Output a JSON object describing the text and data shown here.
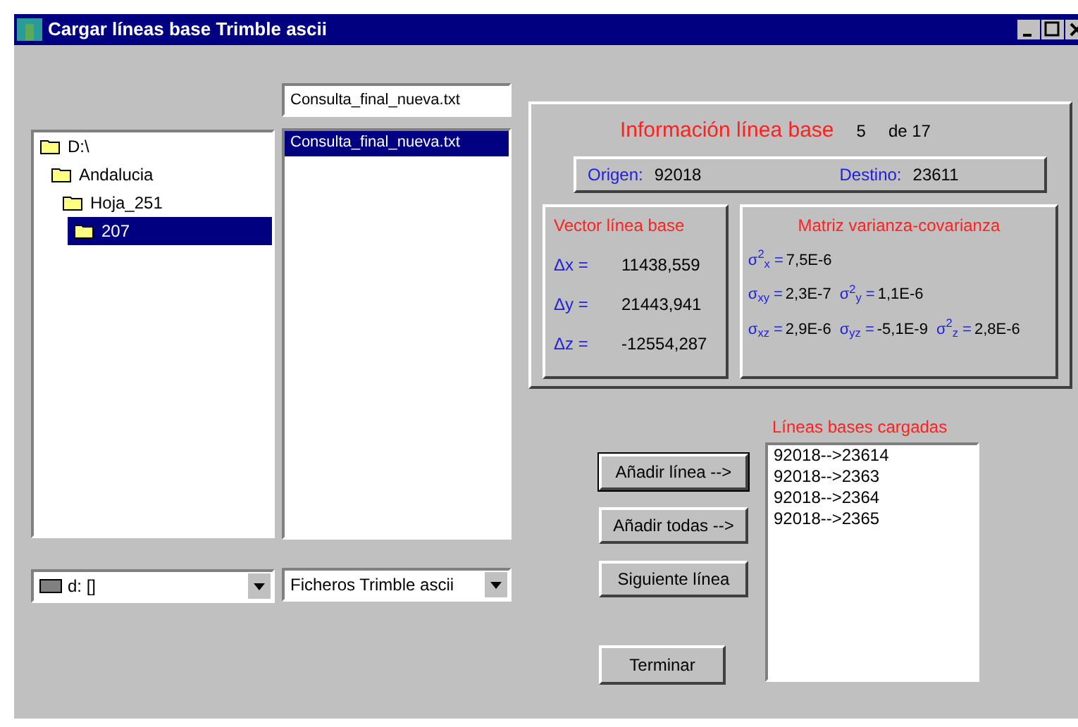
{
  "window": {
    "title": "Cargar líneas base Trimble ascii"
  },
  "folder_tree": [
    {
      "label": "D:\\",
      "selected": false,
      "children": [
        {
          "label": "Andalucia",
          "selected": false,
          "children": [
            {
              "label": "Hoja_251",
              "selected": false,
              "children": [
                {
                  "label": "207",
                  "selected": true
                }
              ]
            }
          ]
        }
      ]
    }
  ],
  "drive_select": {
    "value": "d: []"
  },
  "file_name": {
    "value": "Consulta_final_nueva.txt"
  },
  "file_list": [
    {
      "label": "Consulta_final_nueva.txt",
      "selected": true
    }
  ],
  "file_type_select": {
    "value": "Ficheros Trimble ascii"
  },
  "info": {
    "title": "Información línea base",
    "index": "5",
    "of": "de 17",
    "origin_label": "Origen:",
    "origin": "92018",
    "destination_label": "Destino:",
    "destination": "23611",
    "vector_title": "Vector línea base",
    "vector": [
      {
        "label": "Δx =",
        "value": "11438,559"
      },
      {
        "label": "Δy =",
        "value": "21443,941"
      },
      {
        "label": "Δz =",
        "value": "-12554,287"
      }
    ],
    "matrix_title": "Matriz varianza-covarianza",
    "matrix_rows": [
      [
        {
          "symbol": "σ$^{2}$$_{x}$ =",
          "value": "7,5E-6"
        }
      ],
      [
        {
          "symbol": "σ$_{xy}$ =",
          "value": "2,3E-7"
        },
        {
          "symbol": "σ$^{2}$$_{y}$ =",
          "value": "1,1E-6"
        }
      ],
      [
        {
          "symbol": "σ$_{xz}$ =",
          "value": "2,9E-6"
        },
        {
          "symbol": "σ$_{yz}$ =",
          "value": "-5,1E-9"
        },
        {
          "symbol": "σ$^{2}$$_{z}$ =",
          "value": "2,8E-6"
        }
      ]
    ]
  },
  "buttons": [
    {
      "label": "Añadir línea -->",
      "focused": true
    },
    {
      "label": "Añadir todas -->",
      "focused": false
    },
    {
      "label": "Siguiente línea",
      "focused": false
    }
  ],
  "loaded_title": "Líneas bases cargadas",
  "loaded_lines": [
    "92018-->23614",
    "92018-->2363",
    "92018-->2364",
    "92018-->2365"
  ],
  "finish_button": {
    "label": "Terminar"
  }
}
